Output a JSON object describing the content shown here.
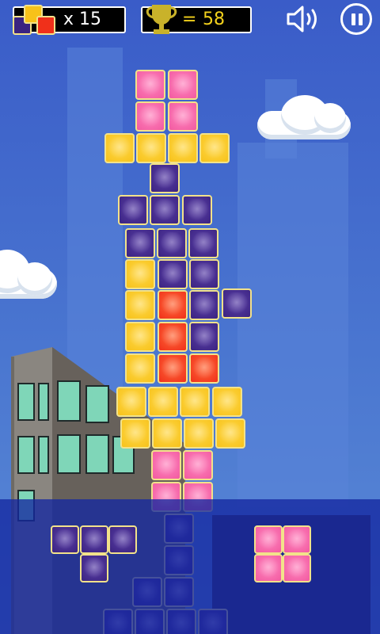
{
  "hud": {
    "pieces_multiplier": "x 15",
    "score_prefix": "=",
    "score": "58"
  },
  "icons": {
    "pieces": "tetromino-stack-icon",
    "trophy": "trophy-icon",
    "sound": "speaker-icon",
    "pause": "pause-icon"
  },
  "colors": {
    "yellow": "#f7c21a",
    "purple": "#3b2380",
    "pink": "#f25aa0",
    "red": "#f0301a",
    "score": "#f3d11c",
    "water": "#1428a0"
  }
}
